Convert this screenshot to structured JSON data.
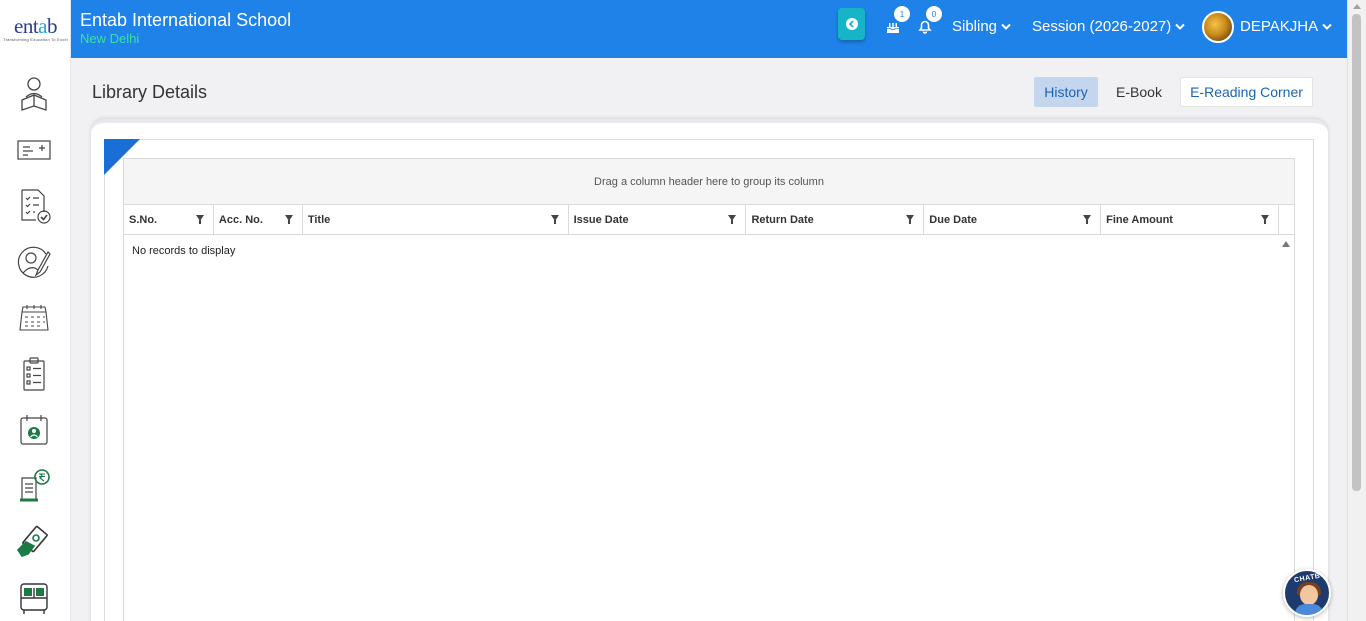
{
  "sidebar": {
    "logo_text_a": "ent",
    "logo_text_accent": "a",
    "logo_text_b": "b",
    "logo_tagline": "Transforming Education To Excel",
    "items": [
      {
        "icon": "reading-student-icon"
      },
      {
        "icon": "notice-board-icon"
      },
      {
        "icon": "checklist-icon"
      },
      {
        "icon": "profile-edit-icon"
      },
      {
        "icon": "calendar-grid-icon"
      },
      {
        "icon": "clipboard-list-icon"
      },
      {
        "icon": "attendance-calendar-icon"
      },
      {
        "icon": "fee-receipt-icon"
      },
      {
        "icon": "payment-hand-icon"
      },
      {
        "icon": "school-bus-icon"
      }
    ]
  },
  "header": {
    "school_name": "Entab International School",
    "school_city": "New Delhi",
    "cake_badge": "1",
    "bell_badge": "0",
    "sibling_label": "Sibling",
    "session_label": "Session (2026-2027)",
    "user_name": "DEPAKJHA"
  },
  "main": {
    "page_title": "Library Details",
    "tabs": [
      {
        "label": "History",
        "active": true
      },
      {
        "label": "E-Book",
        "active": false
      },
      {
        "label": "E-Reading Corner",
        "active": false
      }
    ]
  },
  "grid": {
    "group_panel_text": "Drag a column header here to group its column",
    "columns": [
      "S.No.",
      "Acc. No.",
      "Title",
      "Issue Date",
      "Return Date",
      "Due Date",
      "Fine Amount"
    ],
    "no_records": "No records to display"
  },
  "chatbot": {
    "label": "CHATBOT"
  },
  "colors": {
    "header_bg": "#1e82e8",
    "city_text": "#39e3a0",
    "active_tab_bg": "#c3d6ee",
    "corner_accent": "#1a6fd6",
    "back_button": "#17b4c8"
  }
}
